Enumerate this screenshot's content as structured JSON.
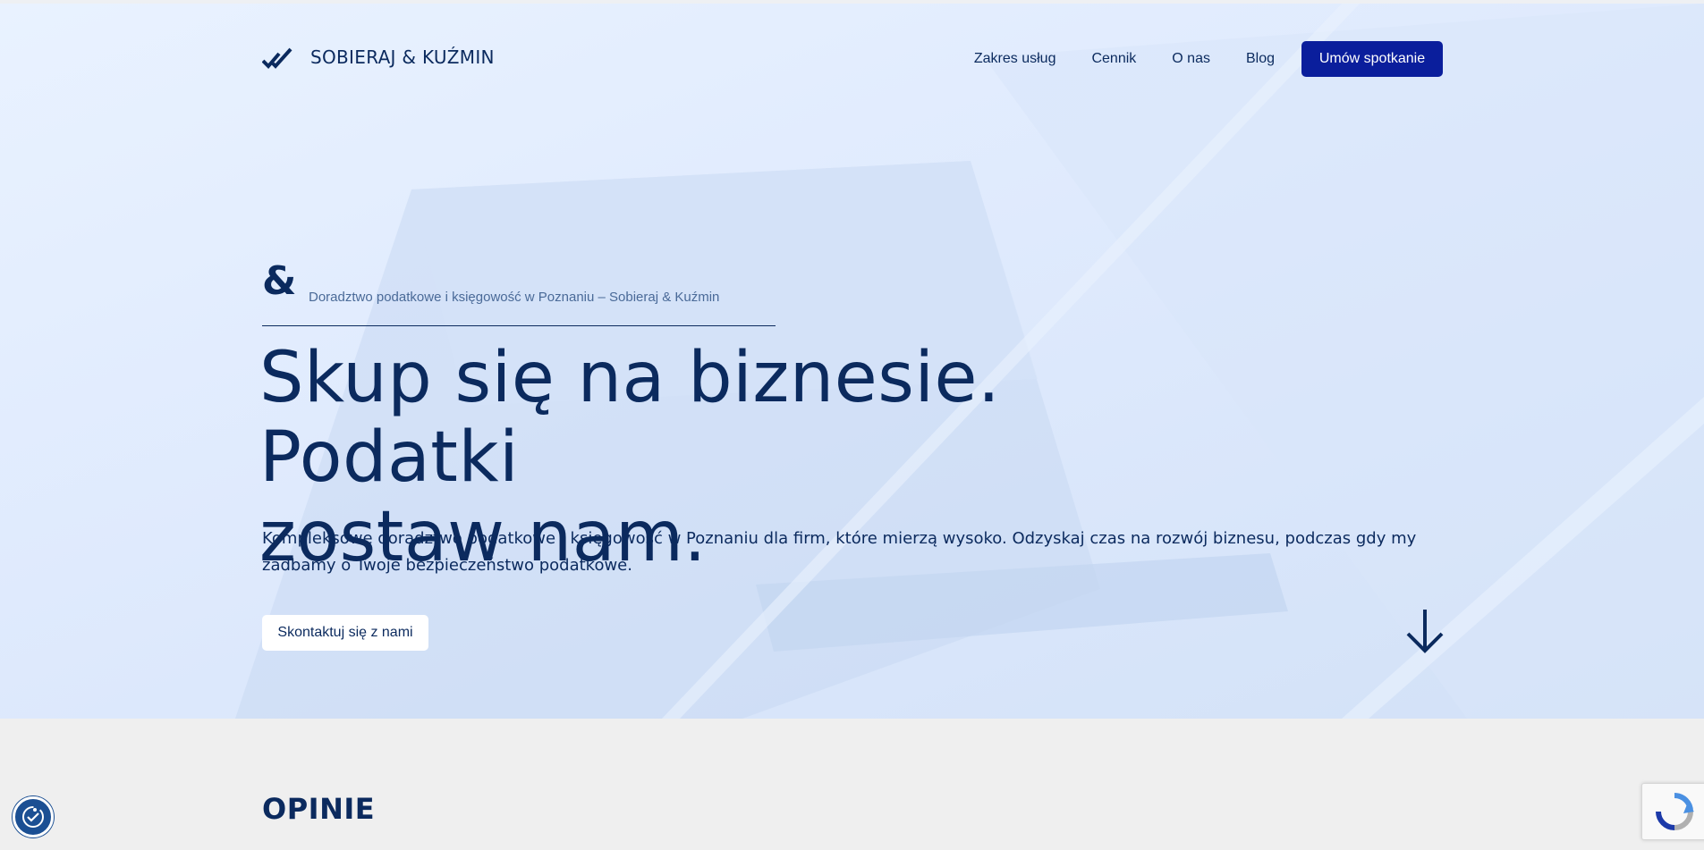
{
  "brand": {
    "name": "SOBIERAJ & KUŹMIN",
    "logo_icon": "double-check-trend-icon"
  },
  "nav": {
    "items": [
      {
        "label": "Zakres usług"
      },
      {
        "label": "Cennik"
      },
      {
        "label": "O nas"
      },
      {
        "label": "Blog"
      }
    ],
    "cta_label": "Umów spotkanie"
  },
  "hero": {
    "ampersand": "&",
    "eyebrow": "Doradztwo podatkowe i księgowość w Poznaniu – Sobieraj & Kuźmin",
    "headline_line1": "Skup się na biznesie. Podatki",
    "headline_line2": "zostaw nam.",
    "lead_line1": "Kompleksowe doradztwo podatkowe i księgowość w Poznaniu dla firm, które mierzą wysoko. Odzyskaj czas na rozwój biznesu, podczas gdy my",
    "lead_line2": "zadbamy o Twoje bezpieczeństwo podatkowe.",
    "cta_label": "Skontaktuj się z nami",
    "scroll_icon": "arrow-down-icon"
  },
  "reviews": {
    "title": "OPINIE"
  },
  "widgets": {
    "accessibility_icon": "accessibility-icon",
    "recaptcha_icon": "recaptcha-icon"
  },
  "colors": {
    "primary": "#0b2a5e",
    "accent": "#0a1e9c",
    "hero_bg": "#e3edfd",
    "page_bg": "#efefef"
  }
}
